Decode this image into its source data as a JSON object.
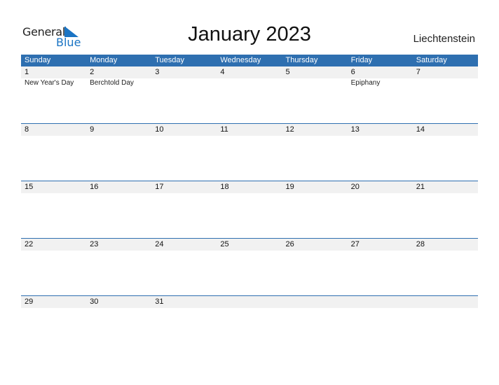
{
  "logo": {
    "line1": "General",
    "line2": "Blue"
  },
  "title": "January 2023",
  "country": "Liechtenstein",
  "colors": {
    "accent": "#2e6fb0",
    "row_bg": "#f1f1f1"
  },
  "weekdays": [
    "Sunday",
    "Monday",
    "Tuesday",
    "Wednesday",
    "Thursday",
    "Friday",
    "Saturday"
  ],
  "weeks": [
    {
      "days": [
        "1",
        "2",
        "3",
        "4",
        "5",
        "6",
        "7"
      ],
      "holidays": [
        "New Year's Day",
        "Berchtold Day",
        "",
        "",
        "",
        "Epiphany",
        ""
      ]
    },
    {
      "days": [
        "8",
        "9",
        "10",
        "11",
        "12",
        "13",
        "14"
      ],
      "holidays": [
        "",
        "",
        "",
        "",
        "",
        "",
        ""
      ]
    },
    {
      "days": [
        "15",
        "16",
        "17",
        "18",
        "19",
        "20",
        "21"
      ],
      "holidays": [
        "",
        "",
        "",
        "",
        "",
        "",
        ""
      ]
    },
    {
      "days": [
        "22",
        "23",
        "24",
        "25",
        "26",
        "27",
        "28"
      ],
      "holidays": [
        "",
        "",
        "",
        "",
        "",
        "",
        ""
      ]
    },
    {
      "days": [
        "29",
        "30",
        "31",
        "",
        "",
        "",
        ""
      ],
      "holidays": [
        "",
        "",
        "",
        "",
        "",
        "",
        ""
      ]
    }
  ]
}
